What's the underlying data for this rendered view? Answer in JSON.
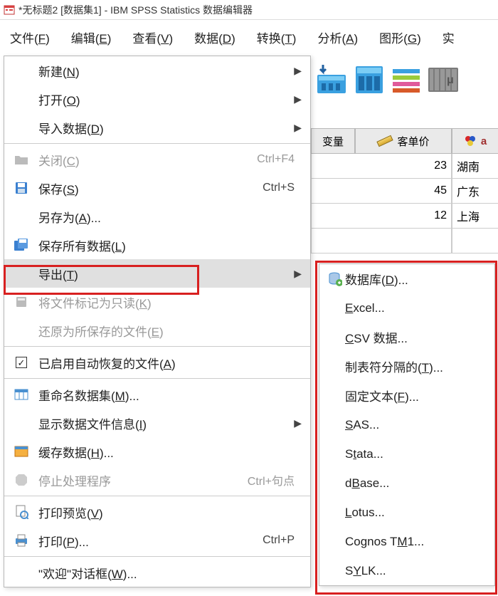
{
  "title": "*无标题2 [数据集1] - IBM SPSS Statistics 数据编辑器",
  "menubar": {
    "file": "文件(<u>F</u>)",
    "edit": "编辑(<u>E</u>)",
    "view": "查看(<u>V</u>)",
    "data": "数据(<u>D</u>)",
    "transform": "转换(<u>T</u>)",
    "analyze": "分析(<u>A</u>)",
    "graphs": "图形(<u>G</u>)",
    "last": "实"
  },
  "columns": {
    "c1_suffix": "变量",
    "c2": "客单价",
    "c3_prefix": "a"
  },
  "rows": [
    {
      "num": "23",
      "txt": "湖南"
    },
    {
      "num": "45",
      "txt": "广东"
    },
    {
      "num": "12",
      "txt": "上海"
    }
  ],
  "filemenu": {
    "new": "新建(<u>N</u>)",
    "open": "打开(<u>O</u>)",
    "import": "导入数据(<u>D</u>)",
    "close": "关闭(<u>C</u>)",
    "close_sc": "Ctrl+F4",
    "save": "保存(<u>S</u>)",
    "save_sc": "Ctrl+S",
    "saveas": "另存为(<u>A</u>)...",
    "saveall": "保存所有数据(<u>L</u>)",
    "export": "导出(<u>T</u>)",
    "markreadonly": "将文件标记为只读(<u>K</u>)",
    "revert": "还原为所保存的文件(<u>E</u>)",
    "autorecovered": "已启用自动恢复的文件(<u>A</u>)",
    "rename": "重命名数据集(<u>M</u>)...",
    "displayinfo": "显示数据文件信息(<u>I</u>)",
    "cache": "缓存数据(<u>H</u>)...",
    "stop": "停止处理程序",
    "stop_sc": "Ctrl+句点",
    "printpreview": "打印预览(<u>V</u>)",
    "print": "打印(<u>P</u>)...",
    "print_sc": "Ctrl+P",
    "welcome": "\"欢迎\"对话框(<u>W</u>)..."
  },
  "submenu": {
    "database": "数据库(<u>D</u>)...",
    "excel": "<u>E</u>xcel...",
    "csv": "<u>C</u>SV 数据...",
    "tab": "制表符分隔的(<u>T</u>)...",
    "fixed": "固定文本(<u>F</u>)...",
    "sas": "<u>S</u>AS...",
    "stata": "S<u>t</u>ata...",
    "dbase": "d<u>B</u>ase...",
    "lotus": "<u>L</u>otus...",
    "cognos": "Cognos T<u>M</u>1...",
    "sylk": "S<u>Y</u>LK..."
  }
}
